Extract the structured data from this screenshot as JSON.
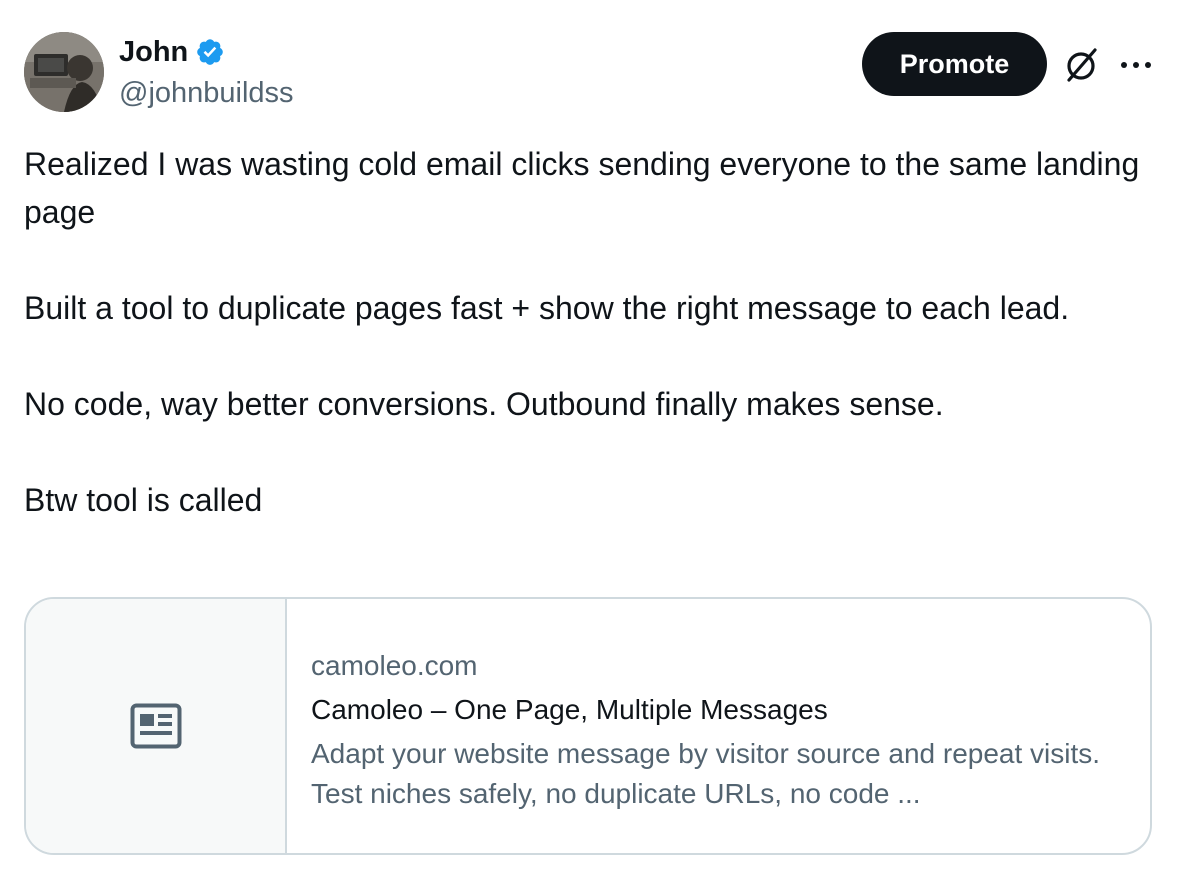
{
  "author": {
    "display_name": "John",
    "handle": "@johnbuildss",
    "verified": true,
    "avatar_icon": "avatar-photo"
  },
  "header_actions": {
    "promote_label": "Promote",
    "grok_icon": "grok-icon",
    "more_icon": "more-icon"
  },
  "tweet": {
    "paragraphs": [
      "Realized I was wasting cold email clicks sending everyone to the same landing page",
      "Built a tool to duplicate pages fast + show the right message to each lead.",
      "No code, way better conversions. Outbound finally makes sense.",
      "Btw tool is called"
    ]
  },
  "link_card": {
    "thumbnail_icon": "article-icon",
    "domain": "camoleo.com",
    "title": "Camoleo – One Page, Multiple Messages",
    "description": "Adapt your website message by visitor source and repeat visits. Test niches safely, no duplicate URLs, no code ..."
  },
  "colors": {
    "text_primary": "#0f1419",
    "text_secondary": "#536471",
    "verified_blue": "#1d9bf0",
    "border": "#cfd9de",
    "card_thumb_bg": "#f7f9f9"
  }
}
